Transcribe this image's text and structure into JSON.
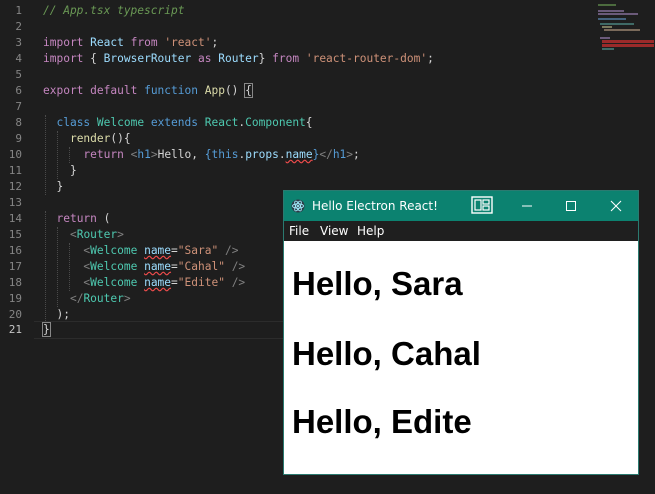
{
  "editor": {
    "line_numbers": [
      "1",
      "2",
      "3",
      "4",
      "5",
      "6",
      "7",
      "8",
      "9",
      "10",
      "11",
      "12",
      "13",
      "14",
      "15",
      "16",
      "17",
      "18",
      "19",
      "20",
      "21"
    ],
    "active_line": "21",
    "code": {
      "l1_comment": "// App.tsx typescript",
      "l3": {
        "kw": "import",
        "name": "React",
        "from": "from",
        "module": "'react'",
        "semi": ";"
      },
      "l4": {
        "kw": "import",
        "lbrace": "{",
        "name": "BrowserRouter",
        "as": "as",
        "alias": "Router",
        "rbrace": "}",
        "from": "from",
        "module": "'react-router-dom'",
        "semi": ";"
      },
      "l6": {
        "export": "export",
        "default": "default",
        "function": "function",
        "name": "App",
        "parens": "()",
        "brace": "{"
      },
      "l8": {
        "class": "class",
        "name": "Welcome",
        "extends": "extends",
        "base_obj": "React",
        "dot": ".",
        "base_cls": "Component",
        "brace": "{"
      },
      "l9": {
        "name": "render",
        "rest": "(){"
      },
      "l10": {
        "return": "return",
        "open_tag_lt": "<",
        "open_tag": "h1",
        "open_tag_gt": ">",
        "text": "Hello, ",
        "expr_open": "{",
        "this": "this",
        "dot1": ".",
        "props": "props",
        "dot2": ".",
        "name": "name",
        "expr_close": "}",
        "close_tag_lt": "</",
        "close_tag": "h1",
        "close_tag_gt": ">",
        "semi": ";"
      },
      "l11": "}",
      "l12": "}",
      "l14": {
        "return": "return",
        "paren": "("
      },
      "l15": {
        "lt": "<",
        "tag": "Router",
        "gt": ">"
      },
      "l16": {
        "lt": "<",
        "tag": "Welcome",
        "attr": "name",
        "eq": "=",
        "value": "\"Sara\"",
        "end": "/>"
      },
      "l17": {
        "lt": "<",
        "tag": "Welcome",
        "attr": "name",
        "eq": "=",
        "value": "\"Cahal\"",
        "end": "/>"
      },
      "l18": {
        "lt": "<",
        "tag": "Welcome",
        "attr": "name",
        "eq": "=",
        "value": "\"Edite\"",
        "end": "/>"
      },
      "l19": {
        "lt": "</",
        "tag": "Router",
        "gt": ">"
      },
      "l20": ");",
      "l21": "}"
    },
    "colors": {
      "background": "#1e1e1e",
      "keyword": "#569cd6",
      "control_keyword": "#c586c0",
      "string": "#ce9178",
      "type": "#4ec9b0",
      "function": "#dcdcaa",
      "variable": "#9cdcfe",
      "comment": "#6a9955"
    }
  },
  "app_window": {
    "title": "Hello Electron React!",
    "titlebar_color": "#0c8270",
    "icons": {
      "app": "electron-atom-icon",
      "snap": "snap-layout-icon",
      "minimize": "minimize-icon",
      "maximize": "maximize-icon",
      "close": "close-icon"
    },
    "menu": [
      "File",
      "View",
      "Help"
    ],
    "greetings": [
      "Hello, Sara",
      "Hello, Cahal",
      "Hello, Edite"
    ]
  }
}
